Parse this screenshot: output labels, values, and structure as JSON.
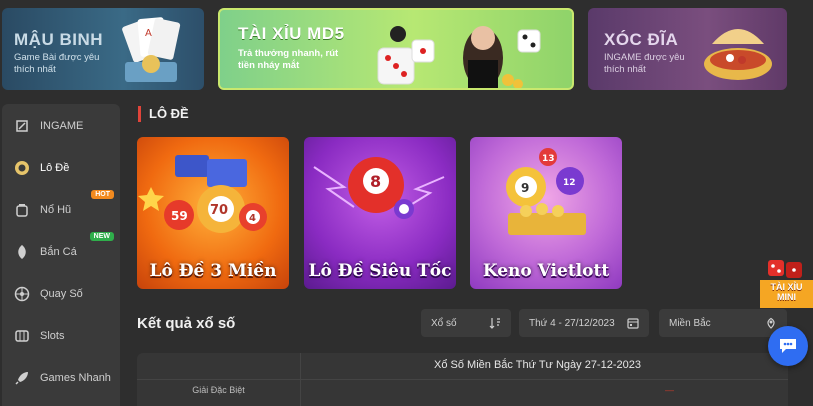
{
  "banners": [
    {
      "title": "MẬU BINH",
      "subtitle": "Game Bài được yêu thích nhất"
    },
    {
      "title": "TÀI XỈU MD5",
      "subtitle": "Trả thưởng nhanh, rút tiền nháy mắt"
    },
    {
      "title": "XÓC ĐĨA",
      "subtitle": "INGAME được yêu thích nhất"
    }
  ],
  "sidebar": {
    "items": [
      {
        "label": "INGAME",
        "icon": "controller-icon"
      },
      {
        "label": "Lô Đề",
        "icon": "lottery-ball-icon",
        "active": true
      },
      {
        "label": "Nổ Hũ",
        "icon": "jar-icon",
        "badge": "HOT"
      },
      {
        "label": "Bắn Cá",
        "icon": "fish-icon",
        "badge": "NEW"
      },
      {
        "label": "Quay Số",
        "icon": "wheel-icon"
      },
      {
        "label": "Slots",
        "icon": "slots-icon"
      },
      {
        "label": "Games Nhanh",
        "icon": "rocket-icon"
      }
    ]
  },
  "section": {
    "title": "LÔ ĐỀ"
  },
  "games": [
    {
      "label": "Lô Đề 3 Miền"
    },
    {
      "label": "Lô Đề Siêu Tốc"
    },
    {
      "label": "Keno Vietlott"
    }
  ],
  "results": {
    "title": "Kết quả xổ số",
    "filter_type": "Xổ số",
    "filter_date": "Thứ 4 - 27/12/2023",
    "filter_region": "Miền Bắc",
    "table_caption": "Xổ Số Miền Bắc Thứ Tư Ngày 27-12-2023",
    "row_label": "Giải Đặc Biệt"
  },
  "widgets": {
    "mini_game": "TÀI XỈU MINI"
  },
  "colors": {
    "accent": "#e0443a",
    "chat": "#2f6df2",
    "hot": "#f28a1f",
    "new": "#2fae4b"
  }
}
